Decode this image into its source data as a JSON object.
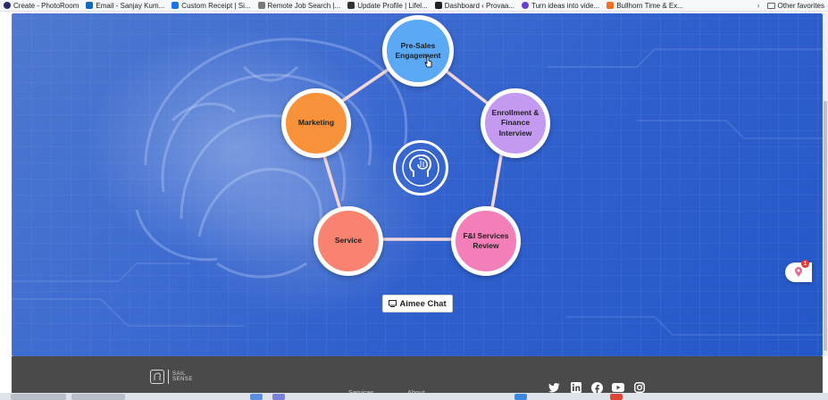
{
  "bookmarks": [
    {
      "label": "Create - PhotoRoom",
      "color": "#2b2b6b"
    },
    {
      "label": "Email - Sanjay Kum...",
      "color": "#0f6cbd"
    },
    {
      "label": "Custom Receipt | Si...",
      "color": "#1a73e8"
    },
    {
      "label": "Remote Job Search |...",
      "color": "#7a7a7a"
    },
    {
      "label": "Update Profile | Lifel...",
      "color": "#333333"
    },
    {
      "label": "Dashboard ‹ Provaa...",
      "color": "#1d2327"
    },
    {
      "label": "Turn ideas into vide...",
      "color": "#6a3fd0"
    },
    {
      "label": "Bullhorn Time & Ex...",
      "color": "#f36f21"
    }
  ],
  "bookmarks_more": "›",
  "other_favorites": "Other favorites",
  "diagram": {
    "nodes": [
      {
        "label": "Pre-Sales Engagement",
        "color": "#5ba8f5"
      },
      {
        "label": "Enrollment & Finance Interview",
        "color": "#c39af0"
      },
      {
        "label": "F&I Services Review",
        "color": "#f47fb8"
      },
      {
        "label": "Service",
        "color": "#f98270"
      },
      {
        "label": "Marketing",
        "color": "#f8923a"
      }
    ],
    "center_icon": "ai-brain-head-icon"
  },
  "chat_button": {
    "label": "Aimee Chat",
    "icon": "chat-monitor-icon"
  },
  "side_widget": {
    "icon": "map-pin-icon",
    "badge": "1"
  },
  "footer": {
    "logo_line1": "SAIL",
    "logo_line2": "SENSE",
    "links": [
      "Services",
      "About"
    ],
    "social_icons": [
      "twitter-icon",
      "linkedin-icon",
      "facebook-icon",
      "youtube-icon",
      "instagram-icon"
    ]
  },
  "colors": {
    "hero_blue": "#3d6bd0",
    "footer_bg": "#4a4a4a",
    "connector": "#f1d7dc"
  }
}
